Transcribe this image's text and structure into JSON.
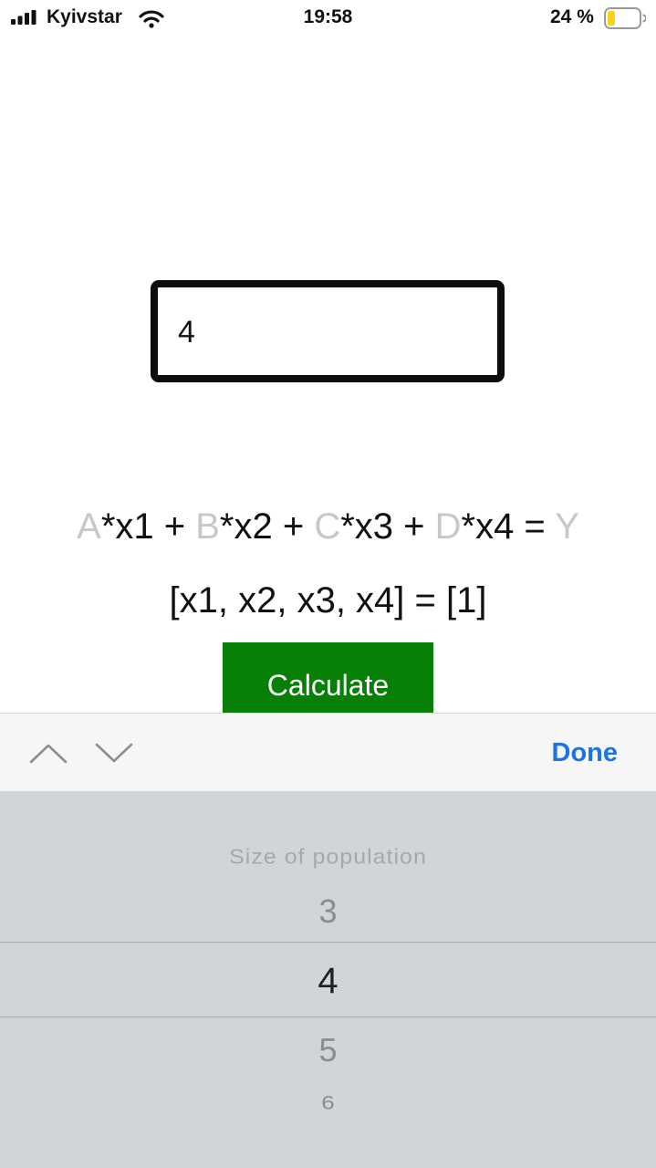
{
  "status_bar": {
    "carrier": "Kyivstar",
    "time": "19:58",
    "battery_percent": "24 %",
    "battery_level": 0.24
  },
  "input": {
    "value": "4"
  },
  "equation": {
    "A": "A",
    "t1": "*x1 + ",
    "B": "B",
    "t2": "*x2 + ",
    "C": "C",
    "t3": "*x3 + ",
    "D": "D",
    "t4": "*x4 = ",
    "Y": "Y"
  },
  "solution": "[x1, x2, x3, x4] = [1]",
  "calculate_label": "Calculate",
  "toolbar": {
    "done_label": "Done"
  },
  "picker": {
    "title": "Size of population",
    "options": [
      "3",
      "4",
      "5",
      "6"
    ],
    "selected": "4"
  },
  "colors": {
    "button_green": "#088008",
    "done_blue": "#1a74e8",
    "battery_yellow": "#f7d21c"
  }
}
